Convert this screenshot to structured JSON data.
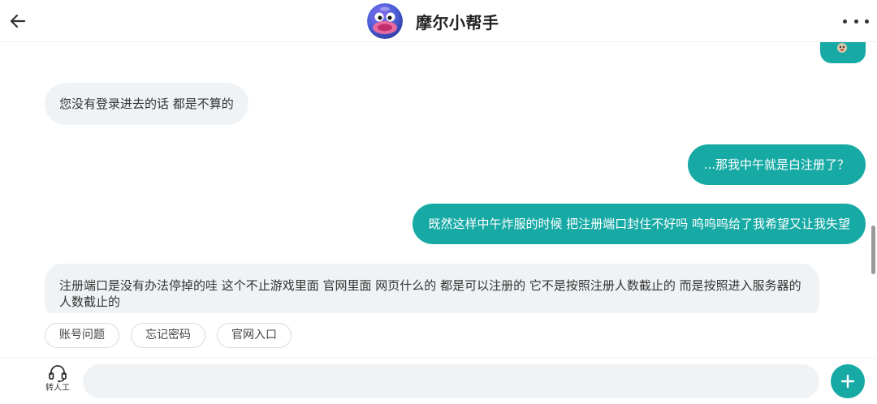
{
  "header": {
    "title": "摩尔小帮手"
  },
  "messages": [
    {
      "from": "bot",
      "text": "您没有登录进去的话 都是不算的"
    },
    {
      "from": "user",
      "text": "...那我中午就是白注册了？"
    },
    {
      "from": "user",
      "text": "既然这样中午炸服的时候 把注册端口封住不好吗 呜呜呜给了我希望又让我失望"
    },
    {
      "from": "bot",
      "text": "注册端口是没有办法停掉的哇 这个不止游戏里面 官网里面 网页什么的 都是可以注册的 它不是按照注册人数截止的 而是按照进入服务器的人数截止的"
    }
  ],
  "quick_replies": [
    "账号问题",
    "忘记密码",
    "官网入口"
  ],
  "input_bar": {
    "human_label": "转人工",
    "placeholder": ""
  },
  "colors": {
    "accent": "#17aaa5",
    "bot_bubble": "#f0f3f5"
  },
  "icons": {
    "back": "arrow-left-icon",
    "more": "more-dots-icon",
    "human": "headset-icon",
    "plus": "plus-icon"
  }
}
